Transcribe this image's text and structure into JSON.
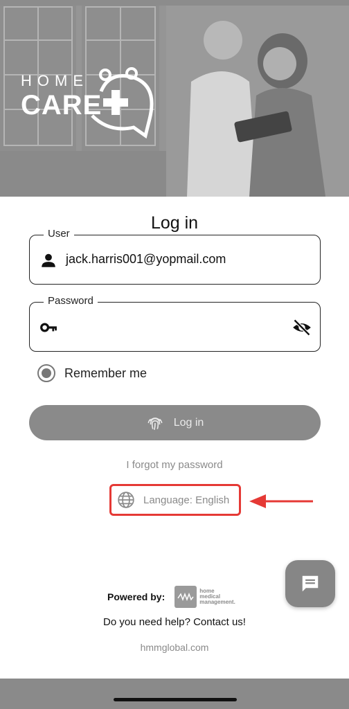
{
  "hero": {
    "logo_home": "HOME",
    "logo_care": "CARE"
  },
  "login": {
    "title": "Log in",
    "user_label": "User",
    "user_value": "jack.harris001@yopmail.com",
    "password_label": "Password",
    "password_value": "",
    "remember_label": "Remember me",
    "remember_checked": true,
    "login_button": "Log in",
    "forgot_link": "I forgot my password",
    "language_button": "Language: English"
  },
  "footer": {
    "powered_label": "Powered by:",
    "brand_lines": [
      "home",
      "medical",
      "management."
    ],
    "help_text": "Do you need help? Contact us!",
    "site": "hmmglobal.com"
  },
  "colors": {
    "highlight": "#e53935",
    "button_gray": "#8a8a8a"
  },
  "icons": [
    "user-icon",
    "key-icon",
    "eye-off-icon",
    "fingerprint-icon",
    "globe-icon",
    "chat-icon"
  ]
}
